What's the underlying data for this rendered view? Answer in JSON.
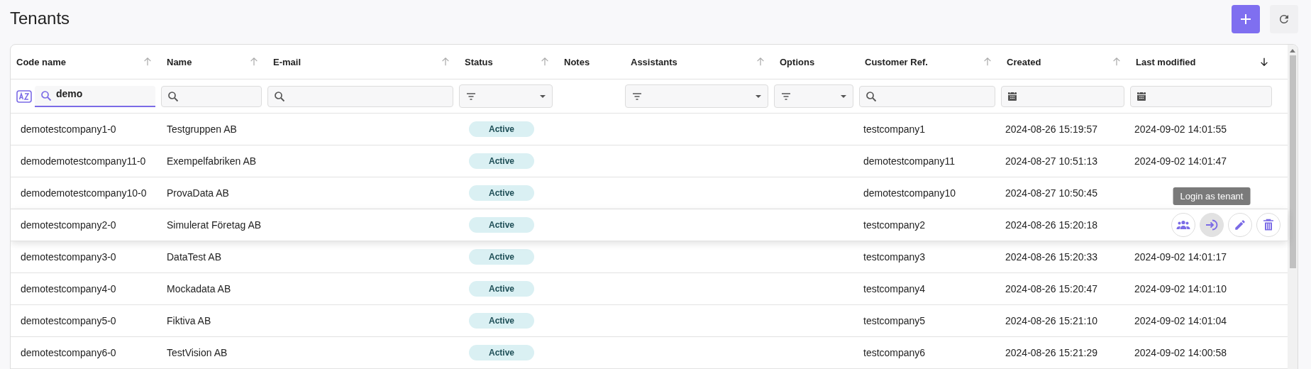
{
  "page": {
    "title": "Tenants"
  },
  "toolbar": [
    {
      "kind": "add"
    },
    {
      "kind": "refresh"
    }
  ],
  "table": {
    "columns": [
      {
        "label": "Code name",
        "sorted": false,
        "filter": {
          "kind": "search",
          "value": "demo"
        },
        "az_toggle": true
      },
      {
        "label": "Name",
        "sorted": false,
        "filter": {
          "kind": "search"
        }
      },
      {
        "label": "E-mail",
        "sorted": false,
        "filter": {
          "kind": "search"
        }
      },
      {
        "label": "Status",
        "sorted": false,
        "filter": {
          "kind": "select"
        }
      },
      {
        "label": "Notes"
      },
      {
        "label": "Assistants",
        "sorted": false,
        "filter": {
          "kind": "select"
        }
      },
      {
        "label": "Options",
        "filter": {
          "kind": "select"
        }
      },
      {
        "label": "Customer Ref.",
        "sorted": false,
        "filter": {
          "kind": "search"
        }
      },
      {
        "label": "Created",
        "sorted": false,
        "filter": {
          "kind": "date"
        }
      },
      {
        "label": "Last modified",
        "sorted": true,
        "filter": {
          "kind": "date"
        }
      }
    ],
    "rows": [
      {
        "code": "demotestcompany1-0",
        "name": "Testgruppen AB",
        "status": "Active",
        "customer_ref": "testcompany1",
        "created": "2024-08-26 15:19:57",
        "modified": "2024-09-02 14:01:55",
        "hovered": false
      },
      {
        "code": "demodemotestcompany11-0",
        "name": "Exempelfabriken AB",
        "status": "Active",
        "customer_ref": "demotestcompany11",
        "created": "2024-08-27 10:51:13",
        "modified": "2024-09-02 14:01:47",
        "hovered": false
      },
      {
        "code": "demodemotestcompany10-0",
        "name": "ProvaData AB",
        "status": "Active",
        "customer_ref": "demotestcompany10",
        "created": "2024-08-27 10:50:45",
        "hovered": false
      },
      {
        "code": "demotestcompany2-0",
        "name": "Simulerat Företag AB",
        "status": "Active",
        "customer_ref": "testcompany2",
        "created": "2024-08-26 15:20:18",
        "hovered": true,
        "actions": [
          {
            "kind": "users",
            "hovered": false
          },
          {
            "kind": "login",
            "hovered": true,
            "tooltip": "Login as tenant"
          },
          {
            "kind": "edit",
            "hovered": false
          },
          {
            "kind": "delete",
            "hovered": false
          }
        ]
      },
      {
        "code": "demotestcompany3-0",
        "name": "DataTest AB",
        "status": "Active",
        "customer_ref": "testcompany3",
        "created": "2024-08-26 15:20:33",
        "modified": "2024-09-02 14:01:17",
        "hovered": false
      },
      {
        "code": "demotestcompany4-0",
        "name": "Mockadata AB",
        "status": "Active",
        "customer_ref": "testcompany4",
        "created": "2024-08-26 15:20:47",
        "modified": "2024-09-02 14:01:10",
        "hovered": false
      },
      {
        "code": "demotestcompany5-0",
        "name": "Fiktiva AB",
        "status": "Active",
        "customer_ref": "testcompany5",
        "created": "2024-08-26 15:21:10",
        "modified": "2024-09-02 14:01:04",
        "hovered": false
      },
      {
        "code": "demotestcompany6-0",
        "name": "TestVision AB",
        "status": "Active",
        "customer_ref": "testcompany6",
        "created": "2024-08-26 15:21:29",
        "modified": "2024-09-02 14:00:58",
        "hovered": false
      }
    ]
  }
}
